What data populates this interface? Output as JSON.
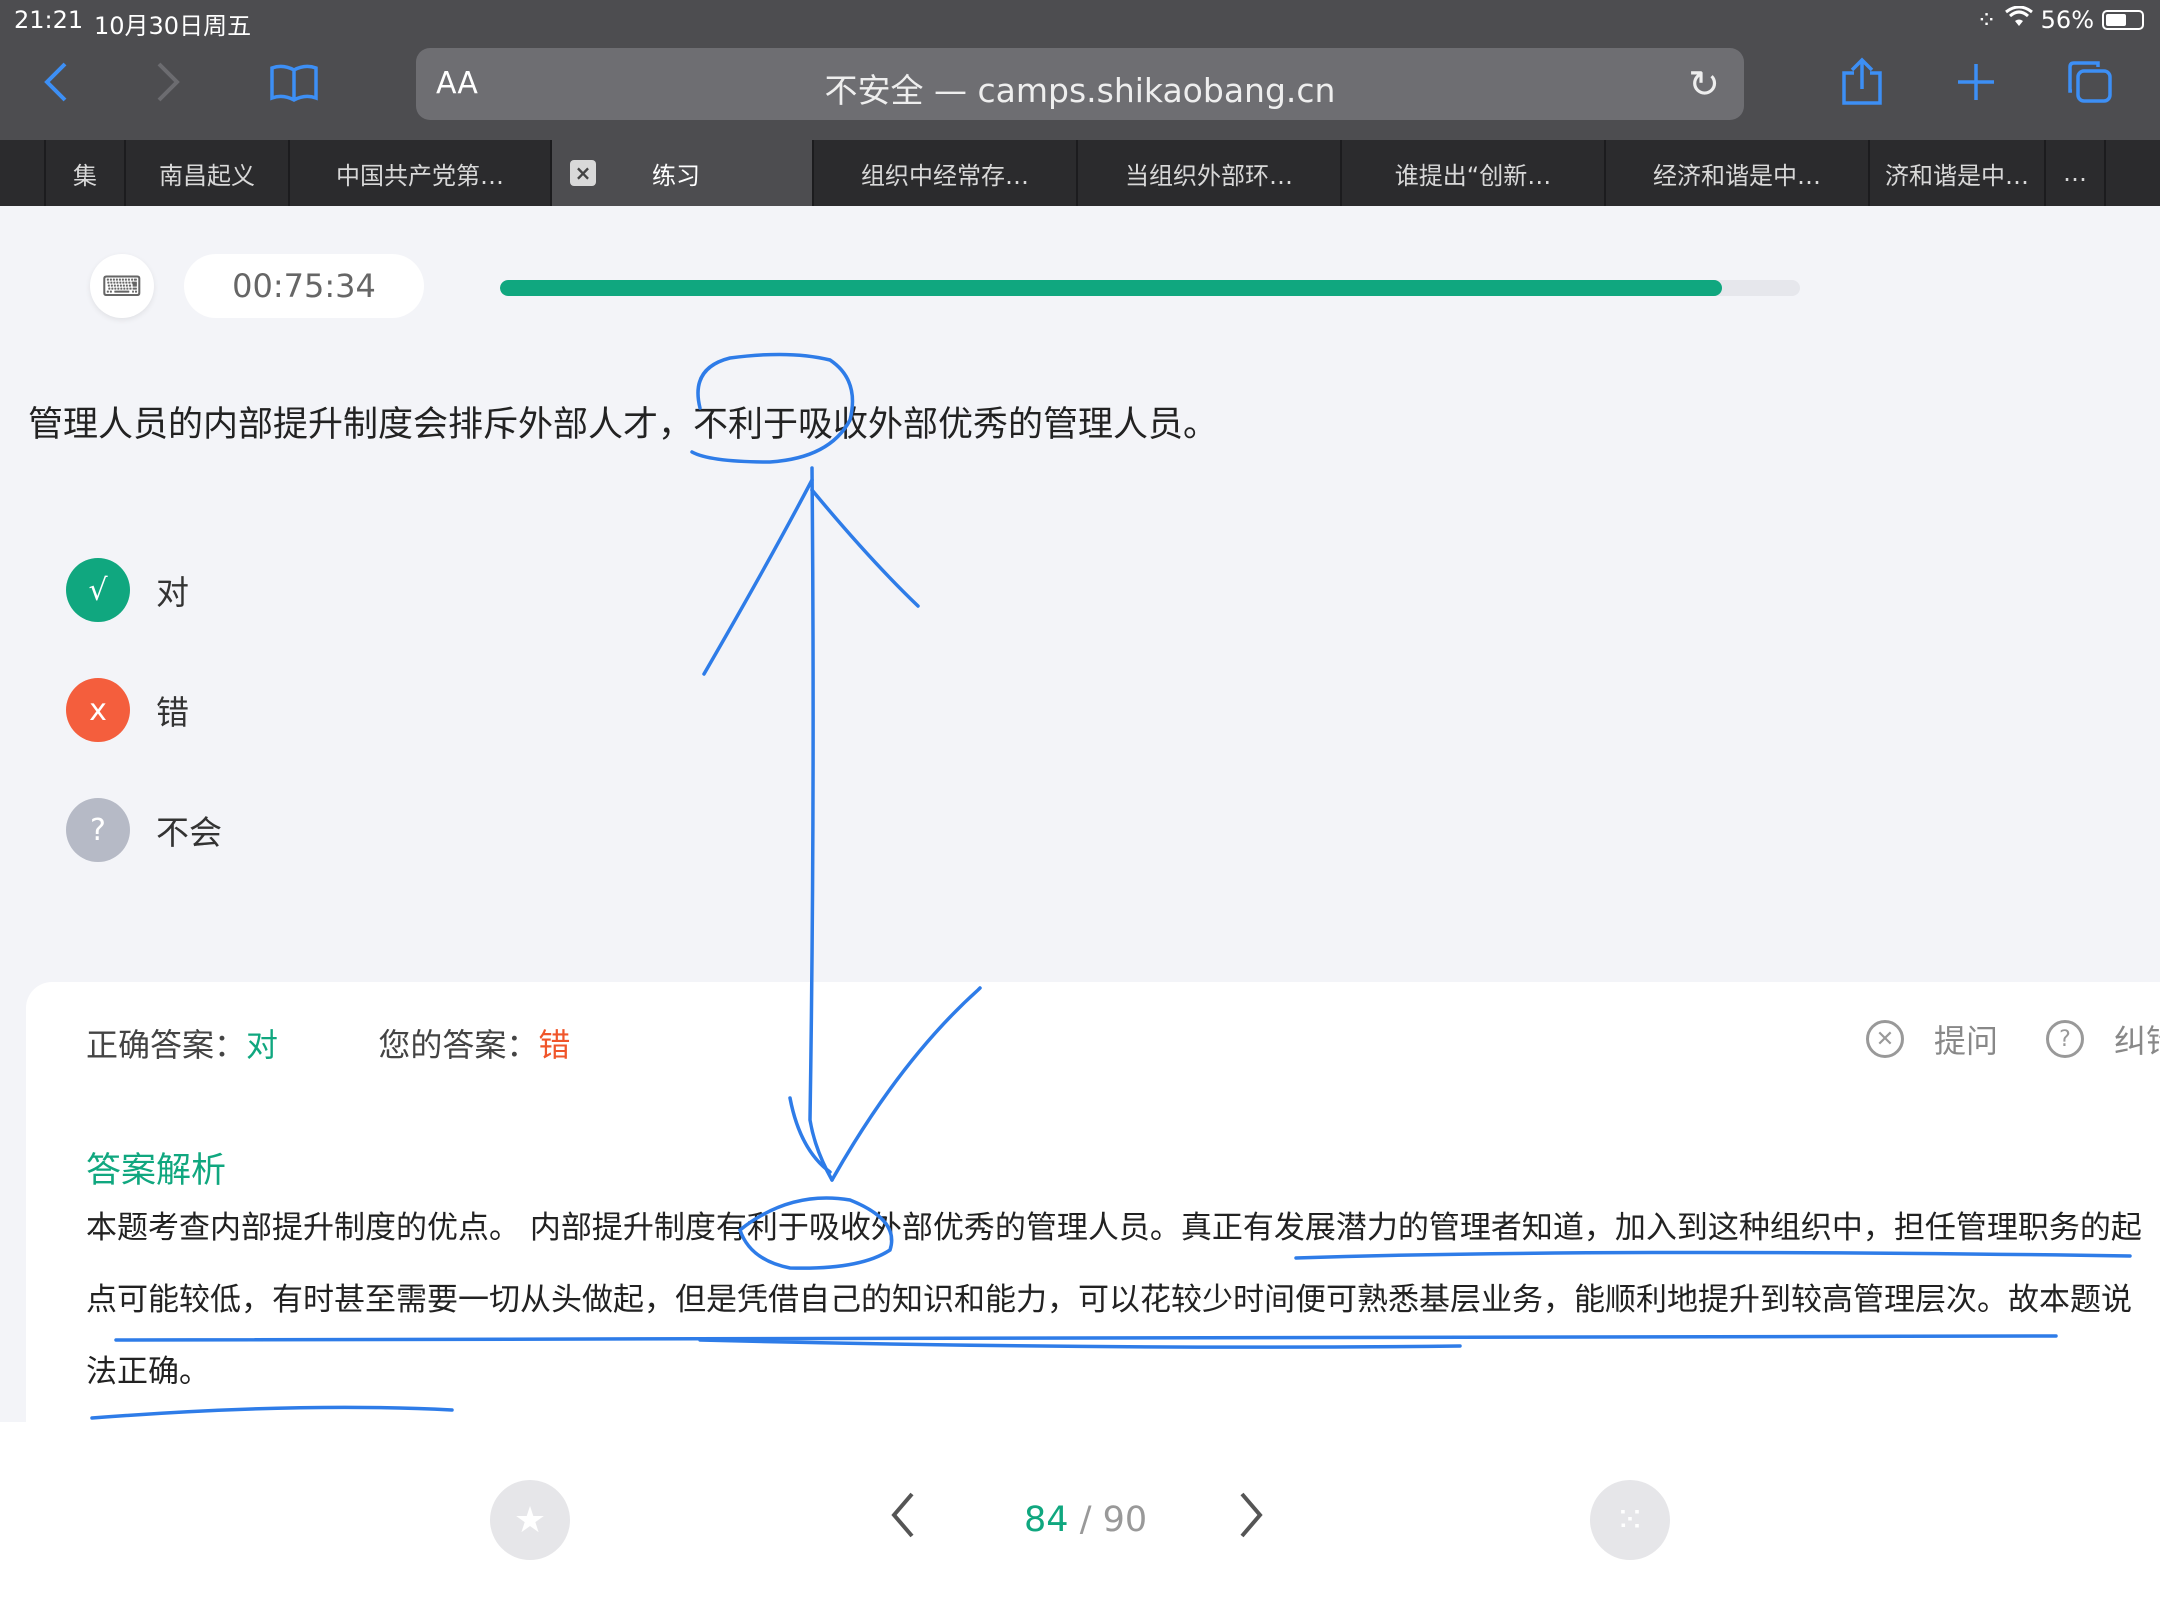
{
  "status": {
    "time": "21:21",
    "date": "10月30日周五",
    "battery": "56%"
  },
  "browser": {
    "aa_label": "AA",
    "address": "不安全 — camps.shikaobang.cn",
    "tabs": [
      "集",
      "南昌起义",
      "中国共产党第…",
      "练习",
      "组织中经常存…",
      "当组织外部环…",
      "谁提出“创新…",
      "经济和谐是中…",
      "济和谐是中…",
      "…"
    ]
  },
  "practice": {
    "timer": "00:75:34",
    "progress": 0.94,
    "question": "管理人员的内部提升制度会排斥外部人才，不利于吸收外部优秀的管理人员。",
    "options": [
      {
        "mark": "√",
        "label": "对",
        "color": "#10a77f"
      },
      {
        "mark": "x",
        "label": "错",
        "color": "#f45e3d"
      },
      {
        "mark": "?",
        "label": "不会",
        "color": "#b6bac6"
      }
    ]
  },
  "answer": {
    "correct_label": "正确答案：",
    "correct_value": "对",
    "mine_label": "您的答案：",
    "mine_value": "错",
    "ask_label": "提问",
    "report_label": "纠错",
    "analysis_title": "答案解析",
    "analysis_text": "本题考查内部提升制度的优点。 内部提升制度有利于吸收外部优秀的管理人员。真正有发展潜力的管理者知道，加入到这种组织中，担任管理职务的起点可能较低，有时甚至需要一切从头做起，但是凭借自己的知识和能力，可以花较少时间便可熟悉基层业务，能顺利地提升到较高管理层次。故本题说法正确。"
  },
  "pager": {
    "current": "84",
    "total": "/ 90"
  },
  "colors": {
    "accent": "#10a77f",
    "wrong": "#f0552a",
    "ink": "#2e7ce8",
    "chrome": "#4d4d50"
  }
}
